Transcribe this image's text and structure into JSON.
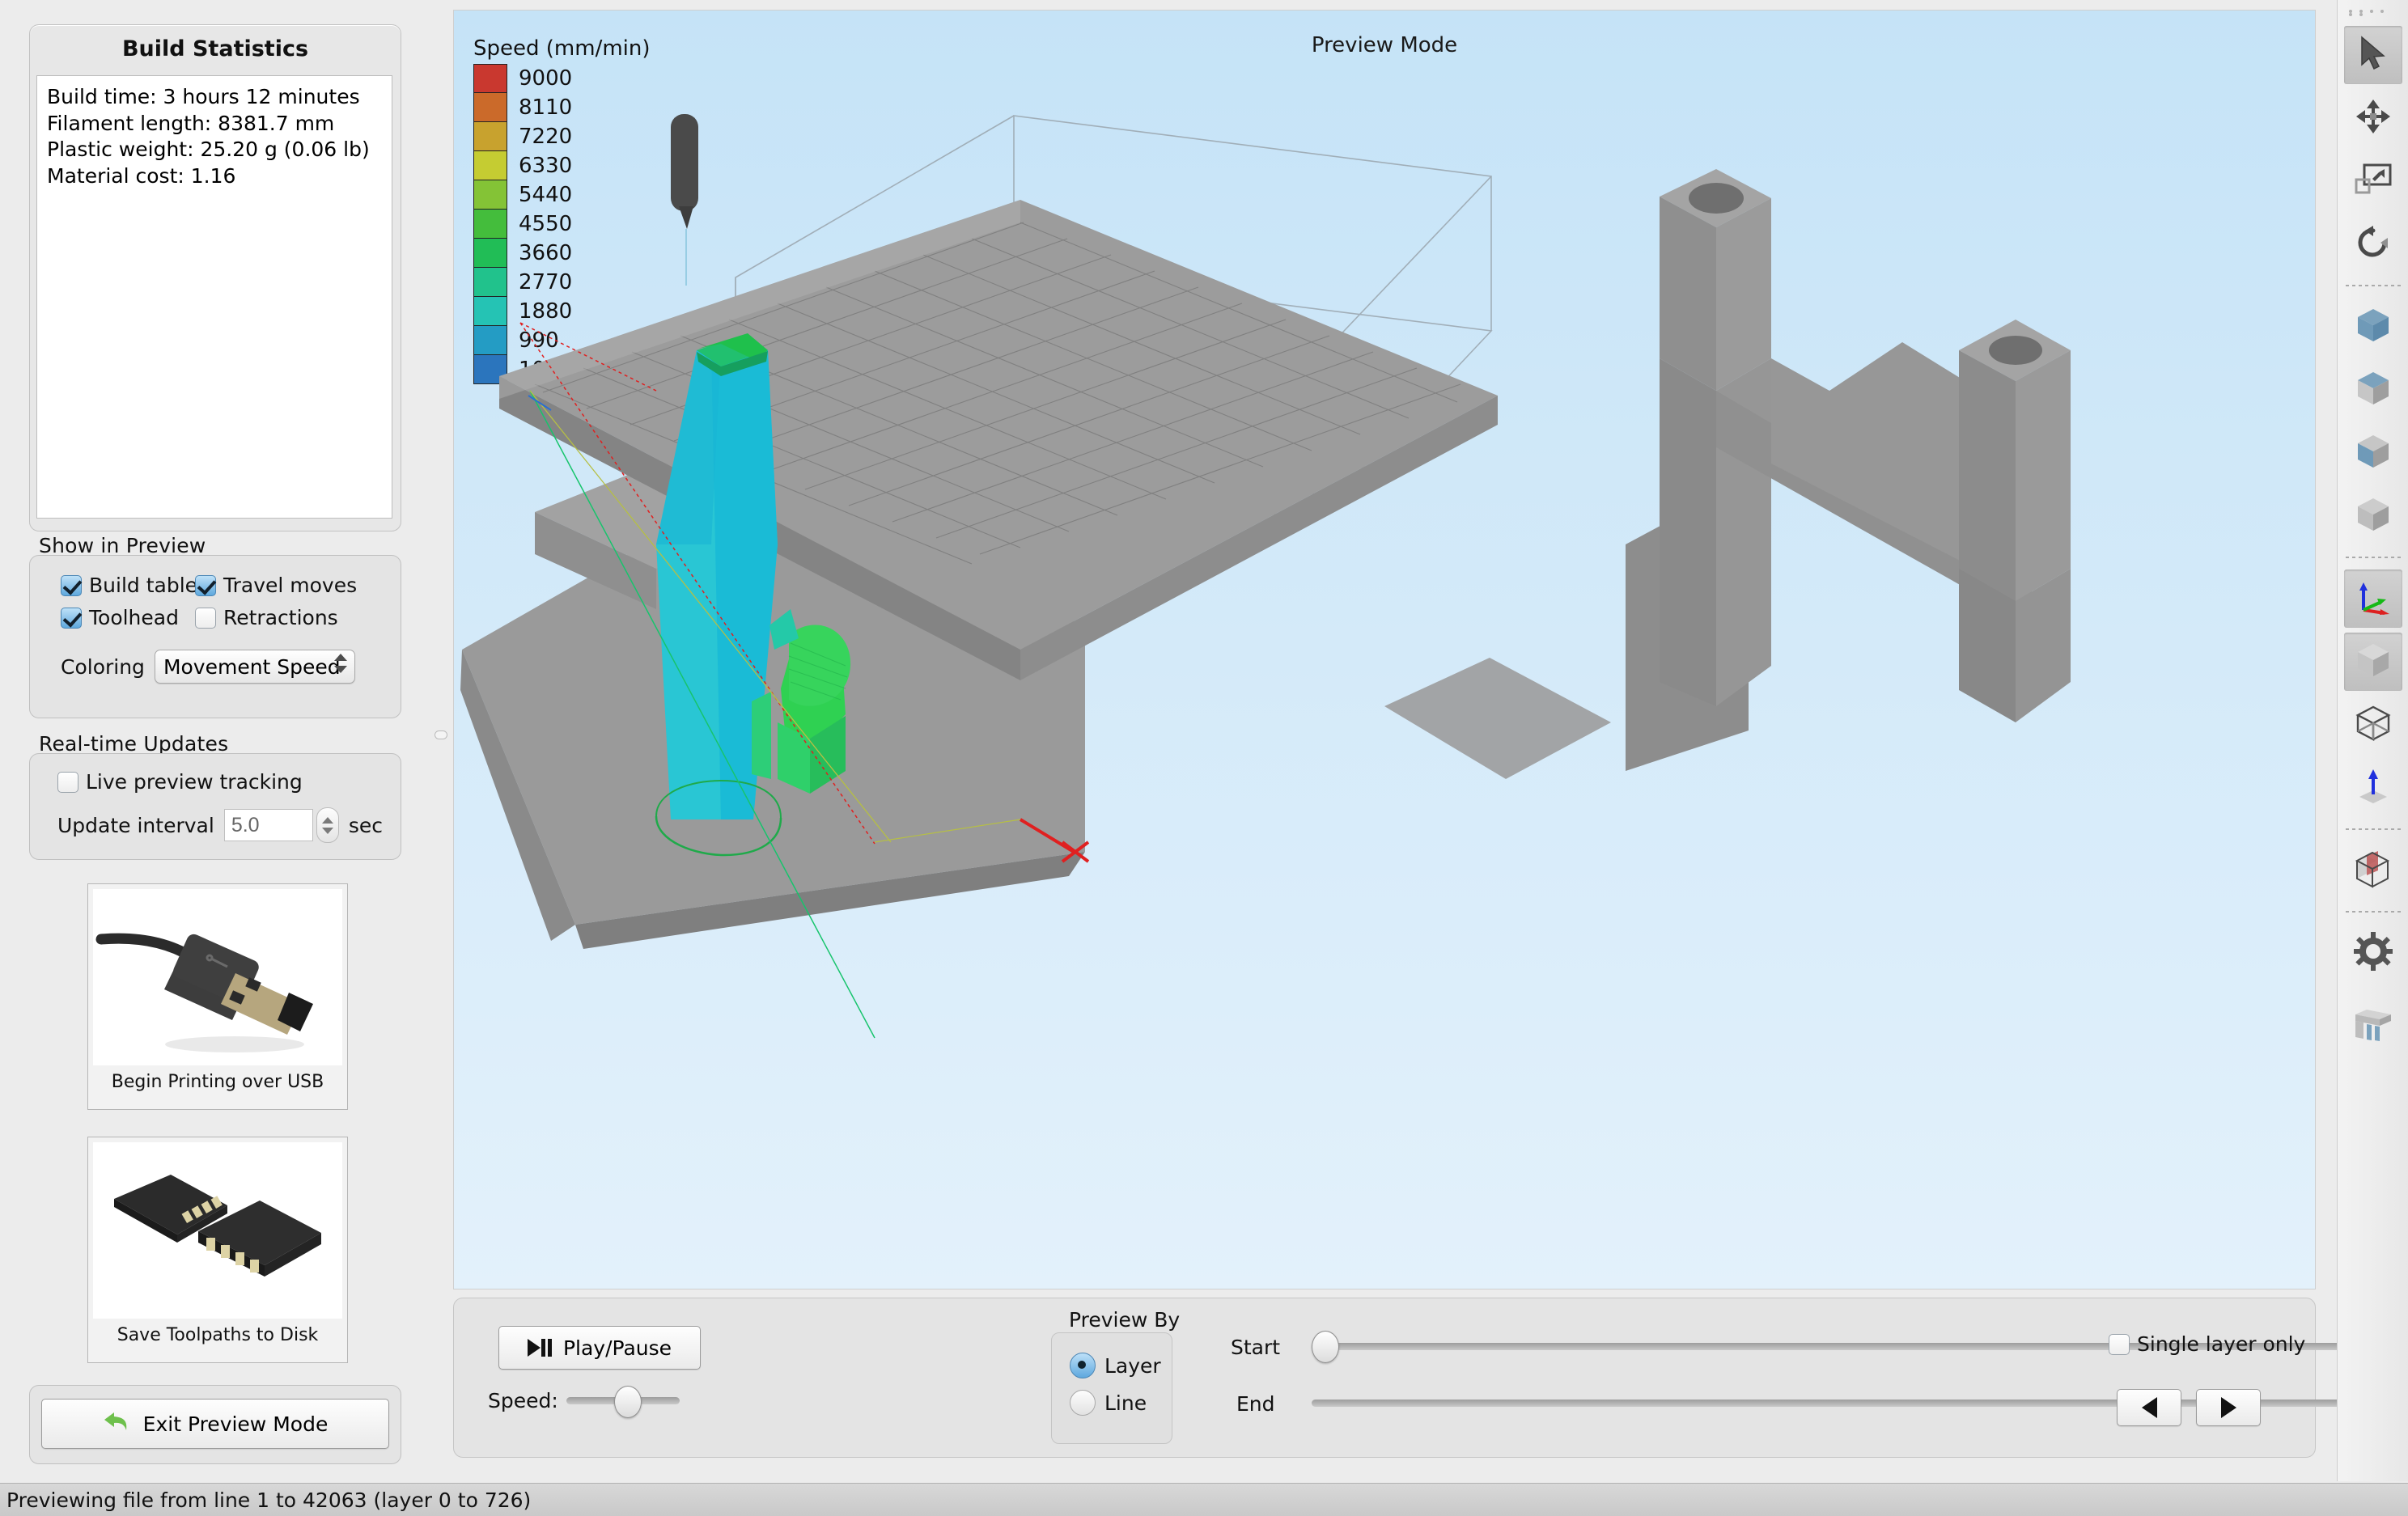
{
  "app": {
    "view_title": "Preview Mode",
    "status_text": "Previewing file from line 1 to 42063 (layer 0 to 726)"
  },
  "build_statistics": {
    "heading": "Build Statistics",
    "lines": [
      "Build time: 3 hours 12 minutes",
      "Filament length: 8381.7 mm",
      "Plastic weight: 25.20 g (0.06 lb)",
      "Material cost: 1.16"
    ]
  },
  "show_in_preview": {
    "title": "Show in Preview",
    "checkboxes": [
      {
        "label": "Build table",
        "checked": true
      },
      {
        "label": "Travel moves",
        "checked": true
      },
      {
        "label": "Toolhead",
        "checked": true
      },
      {
        "label": "Retractions",
        "checked": false
      }
    ],
    "coloring_label": "Coloring",
    "coloring_value": "Movement Speed"
  },
  "realtime_updates": {
    "title": "Real-time Updates",
    "live_tracking_label": "Live preview tracking",
    "live_tracking_checked": false,
    "interval_label": "Update interval",
    "interval_value": "5.0",
    "interval_unit": "sec"
  },
  "actions": {
    "usb_caption": "Begin Printing over USB",
    "sd_caption": "Save Toolpaths to Disk",
    "exit_label": "Exit Preview Mode"
  },
  "controls": {
    "play_pause_label": "Play/Pause",
    "speed_label": "Speed:",
    "preview_by_title": "Preview By",
    "preview_by_options": [
      {
        "label": "Layer",
        "selected": true
      },
      {
        "label": "Line",
        "selected": false
      }
    ],
    "start_label": "Start",
    "end_label": "End",
    "single_layer_label": "Single layer only",
    "single_layer_checked": false,
    "prev_layer_icon": "triangle-left-icon",
    "next_layer_icon": "triangle-right-icon",
    "speed_slider_percent": 55,
    "start_slider_percent": 0,
    "end_slider_percent": 100
  },
  "toolbar": {
    "items": [
      {
        "name": "select-tool",
        "icon": "cursor-arrow-icon",
        "selected": true
      },
      {
        "name": "move-tool",
        "icon": "move-arrows-icon",
        "selected": false
      },
      {
        "name": "scale-tool",
        "icon": "scale-box-icon",
        "selected": false
      },
      {
        "name": "rotate-tool",
        "icon": "rotate-arrow-icon",
        "selected": false
      },
      {
        "name": "view-front",
        "icon": "cube-front-icon",
        "selected": false
      },
      {
        "name": "view-top",
        "icon": "cube-top-icon",
        "selected": false
      },
      {
        "name": "view-side",
        "icon": "cube-side-icon",
        "selected": false
      },
      {
        "name": "view-iso",
        "icon": "cube-plain-icon",
        "selected": false
      },
      {
        "name": "show-axes",
        "icon": "axes-icon",
        "selected": true
      },
      {
        "name": "shaded-view",
        "icon": "cube-shaded-icon",
        "selected": true
      },
      {
        "name": "wireframe-view",
        "icon": "cube-wireframe-icon",
        "selected": false
      },
      {
        "name": "normals-view",
        "icon": "normal-arrow-icon",
        "selected": false
      },
      {
        "name": "cross-section-view",
        "icon": "cross-section-icon",
        "selected": false
      },
      {
        "name": "settings",
        "icon": "gear-icon",
        "selected": false
      },
      {
        "name": "supports",
        "icon": "supports-icon",
        "selected": false
      }
    ]
  },
  "chart_data": {
    "type": "legend",
    "title": "Speed (mm/min)",
    "unit": "mm/min",
    "entries": [
      {
        "value": 9000,
        "color": "#c9382f"
      },
      {
        "value": 8110,
        "color": "#cb6a2a"
      },
      {
        "value": 7220,
        "color": "#c8a22e"
      },
      {
        "value": 6330,
        "color": "#c5cc32"
      },
      {
        "value": 5440,
        "color": "#84c336"
      },
      {
        "value": 4550,
        "color": "#44bd3c"
      },
      {
        "value": 3660,
        "color": "#21bd56"
      },
      {
        "value": 2770,
        "color": "#21c28c"
      },
      {
        "value": 1880,
        "color": "#25c3b4"
      },
      {
        "value": 990,
        "color": "#249cc4"
      },
      {
        "value": 100,
        "color": "#2b75bd"
      }
    ]
  }
}
